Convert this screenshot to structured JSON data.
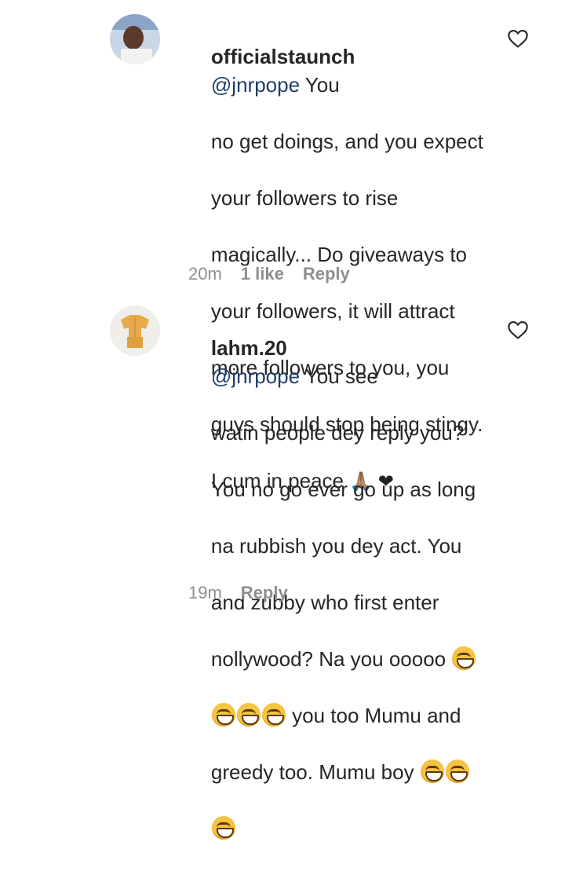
{
  "comments": [
    {
      "username": "officialstaunch",
      "mention": "@jnrpope",
      "body_lines": [
        " You",
        "no get doings, and you expect",
        "your followers to rise",
        "magically... Do giveaways to",
        "your followers, it will attract",
        "more followers to you, you",
        "guys should stop being stingy.",
        "I cum in peace "
      ],
      "emojis_end": "🙏🏽 ❤",
      "time": "20m",
      "likes": "1 like",
      "reply_label": "Reply"
    },
    {
      "username": "lahm.20",
      "mention": "@jnrpope",
      "body_line_1": " You see",
      "body_line_2": "watin people dey reply you?",
      "body_line_3": "You no go ever go up as long",
      "body_line_4": "na rubbish you dey act. You",
      "body_line_5": "and zubby who first enter",
      "body_line_6": "nollywood? Na you ooooo ",
      "body_line_7": " you too Mumu and",
      "body_line_8": "greedy too. Mumu boy ",
      "time": "19m",
      "reply_label": "Reply",
      "emoji_name": "grinning-squinting-face"
    }
  ]
}
